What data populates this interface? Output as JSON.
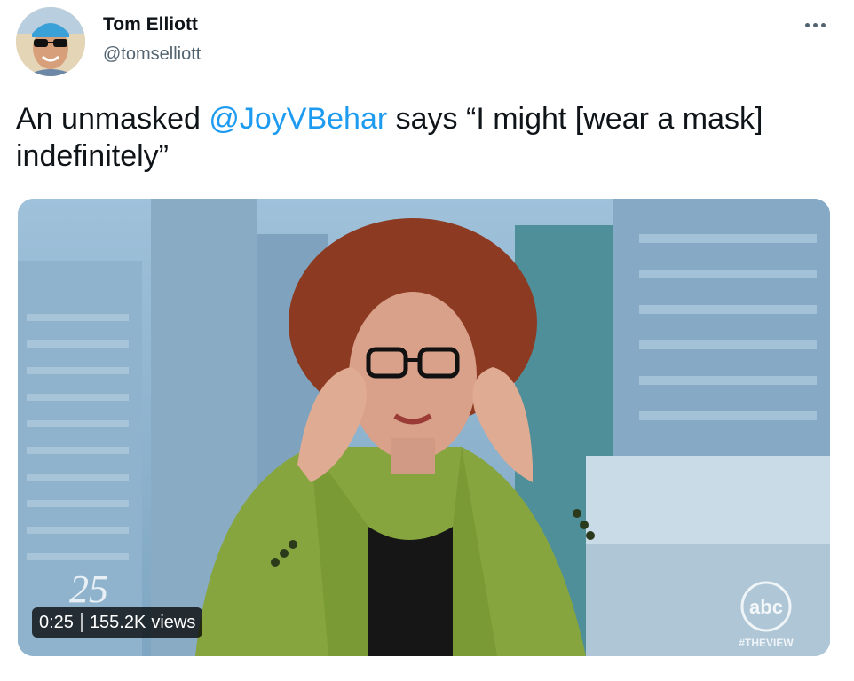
{
  "author": {
    "name": "Tom Elliott",
    "handle": "@tomselliott"
  },
  "more_icon": "more-horizontal-icon",
  "tweet": {
    "text_before": "An unmasked ",
    "mention": "@JoyVBehar",
    "text_after": " says “I might [wear a mask] indefinitely”"
  },
  "video": {
    "duration": "0:25",
    "view_count": "155.2K",
    "views_label": "views",
    "network_logo": "abc",
    "show_hashtag": "#THEVIEW",
    "anniversary_mark": "25"
  },
  "colors": {
    "link": "#1d9bf0",
    "secondary_text": "#536471",
    "primary_text": "#0f1419"
  }
}
